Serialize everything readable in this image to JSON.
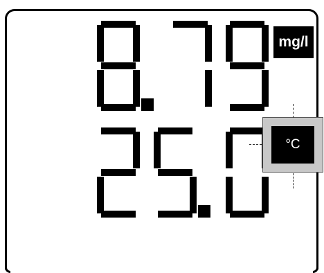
{
  "display": {
    "primary_reading": "8.79",
    "primary_unit": "mg/l",
    "secondary_reading": "25.0",
    "secondary_unit": "°C"
  },
  "colors": {
    "segment": "#000000",
    "background": "#ffffff",
    "highlight": "#c8c8c8"
  }
}
